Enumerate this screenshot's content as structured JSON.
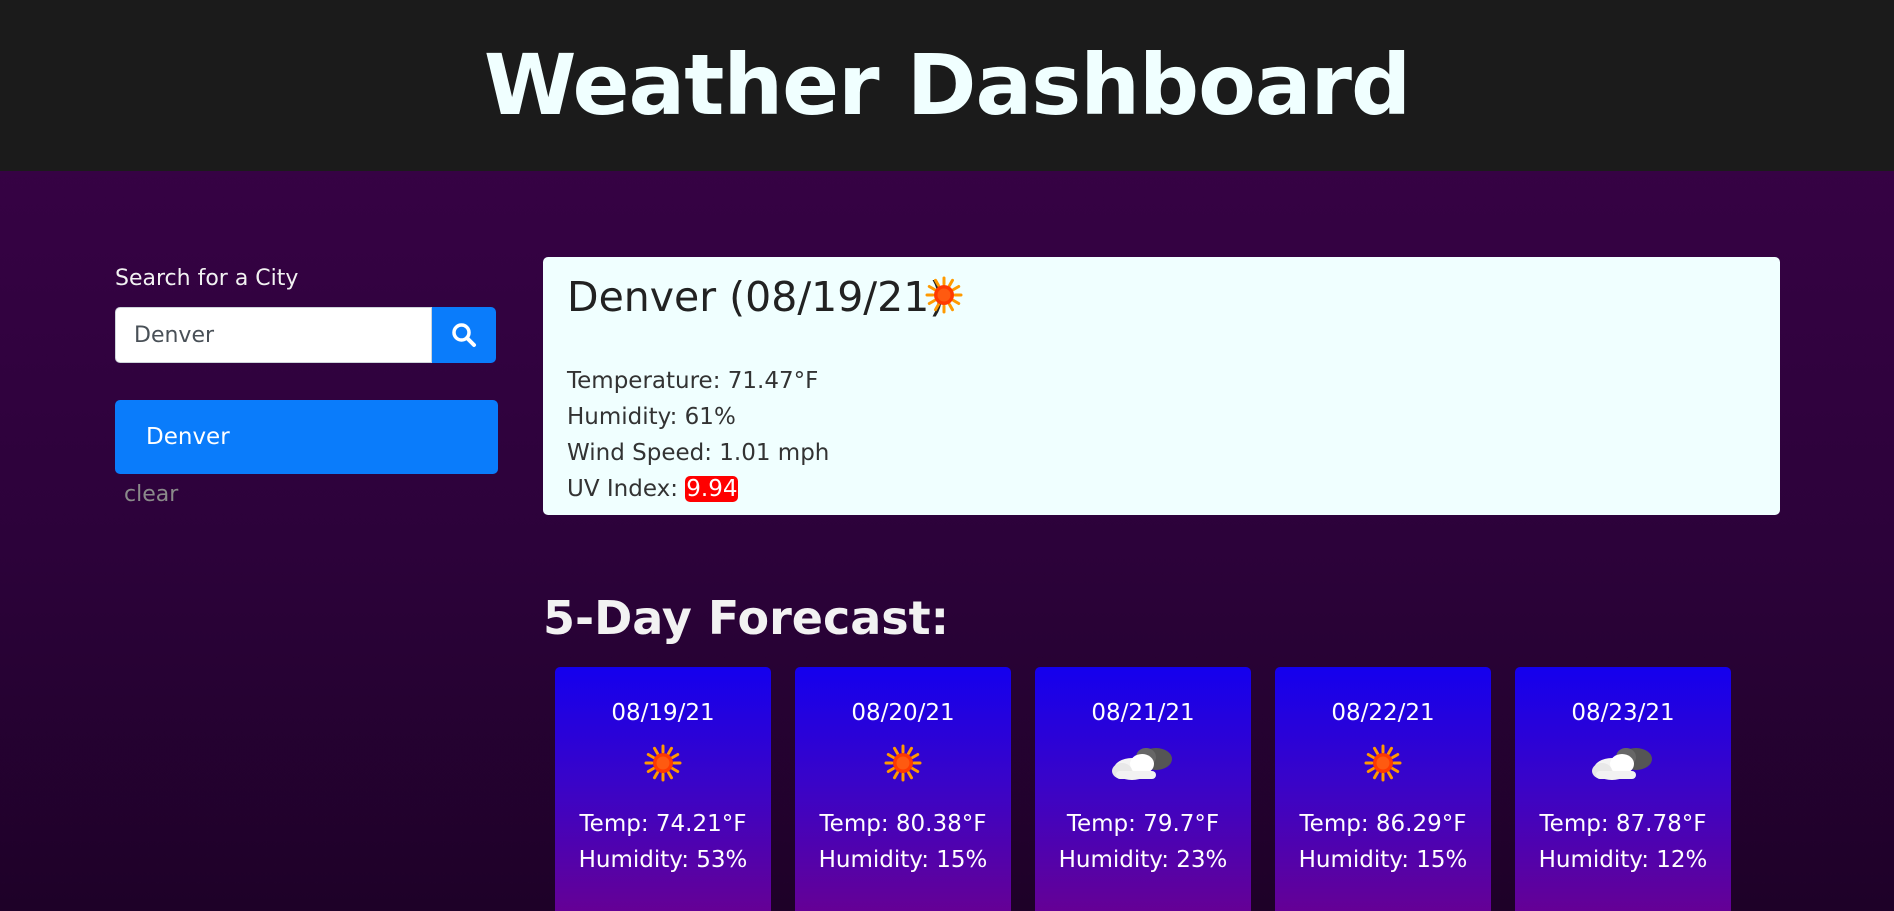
{
  "header": {
    "title": "Weather Dashboard"
  },
  "search": {
    "label": "Search for a City",
    "value": "Denver",
    "button_icon": "search-icon"
  },
  "history": {
    "items": [
      {
        "label": "Denver"
      }
    ],
    "clear_label": "clear"
  },
  "current": {
    "title": "Denver (08/19/21)",
    "icon": "sun-icon",
    "temperature_label": "Temperature: 71.47°F",
    "humidity_label": "Humidity: 61%",
    "wind_label": "Wind Speed: 1.01 mph",
    "uv_label": "UV Index: ",
    "uv_value": "9.94",
    "uv_color": "#ff0000"
  },
  "forecast": {
    "title": "5-Day Forecast:",
    "days": [
      {
        "date": "08/19/21",
        "icon": "sun-icon",
        "temp": "Temp: 74.21°F",
        "humidity": "Humidity: 53%"
      },
      {
        "date": "08/20/21",
        "icon": "sun-icon",
        "temp": "Temp: 80.38°F",
        "humidity": "Humidity: 15%"
      },
      {
        "date": "08/21/21",
        "icon": "cloud-icon",
        "temp": "Temp: 79.7°F",
        "humidity": "Humidity: 23%"
      },
      {
        "date": "08/22/21",
        "icon": "sun-icon",
        "temp": "Temp: 86.29°F",
        "humidity": "Humidity: 15%"
      },
      {
        "date": "08/23/21",
        "icon": "cloud-icon",
        "temp": "Temp: 87.78°F",
        "humidity": "Humidity: 12%"
      }
    ]
  },
  "colors": {
    "header_bg": "#1b1b1b",
    "accent": "#0a7cfb",
    "card_bg": "#f0ffff"
  }
}
